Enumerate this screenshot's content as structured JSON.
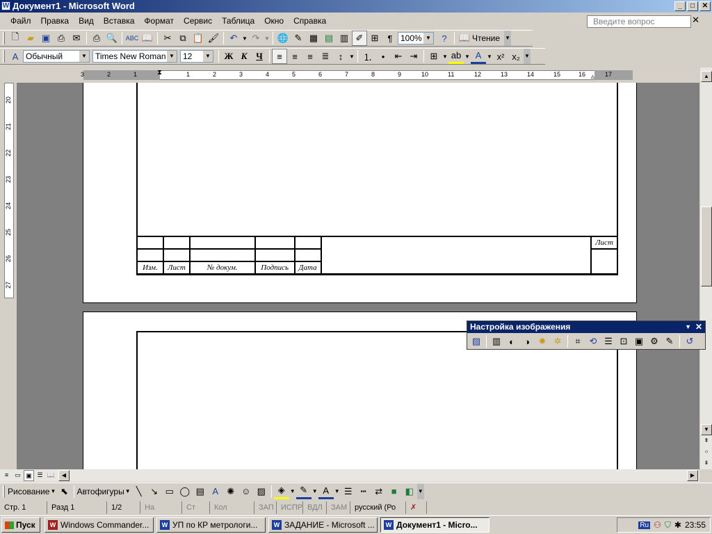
{
  "window": {
    "title": "Документ1 - Microsoft Word",
    "controls": [
      "_",
      "□",
      "✕"
    ]
  },
  "menu": {
    "items": [
      "Файл",
      "Правка",
      "Вид",
      "Вставка",
      "Формат",
      "Сервис",
      "Таблица",
      "Окно",
      "Справка"
    ],
    "help_placeholder": "Введите вопрос",
    "close": "✕"
  },
  "standard_toolbar": {
    "zoom": "100%",
    "reading_label": "Чтение",
    "pilcrow": "¶"
  },
  "format_toolbar": {
    "style": "Обычный",
    "font": "Times New Roman",
    "size": "12",
    "bold": "Ж",
    "italic": "К",
    "underline": "Ч",
    "superscript": "x²",
    "subscript": "x₂"
  },
  "ruler": {
    "numbers": [
      "3",
      "2",
      "1",
      "1",
      "2",
      "3",
      "4",
      "5",
      "6",
      "7",
      "8",
      "9",
      "10",
      "11",
      "12",
      "13",
      "14",
      "15",
      "16",
      "17"
    ]
  },
  "vruler": {
    "numbers": [
      "20",
      "21",
      "22",
      "23",
      "24",
      "25",
      "26",
      "27"
    ]
  },
  "stamp": {
    "col_labels": [
      "Изм.",
      "Лист",
      "№ докум.",
      "Подпись",
      "Дата"
    ],
    "sheet_label": "Лист"
  },
  "picture_toolbar": {
    "title": "Настройка изображения"
  },
  "drawing_toolbar": {
    "draw_label": "Рисование",
    "autoshapes_label": "Автофигуры"
  },
  "status": {
    "page": "Стр.  1",
    "section": "Разд  1",
    "pages": "1/2",
    "at": "На",
    "line": "Ст",
    "col": "Кол",
    "rec": "ЗАП",
    "trk": "ИСПР",
    "ext": "ВДЛ",
    "ovr": "ЗАМ",
    "lang": "русский (Ро"
  },
  "taskbar": {
    "start": "Пуск",
    "tasks": [
      "Windows Commander...",
      "УП по КР метрологи...",
      "ЗАДАНИЕ - Microsoft ...",
      "Документ1 - Micro..."
    ],
    "clock": "23:55",
    "tray_lang": "Ru"
  }
}
